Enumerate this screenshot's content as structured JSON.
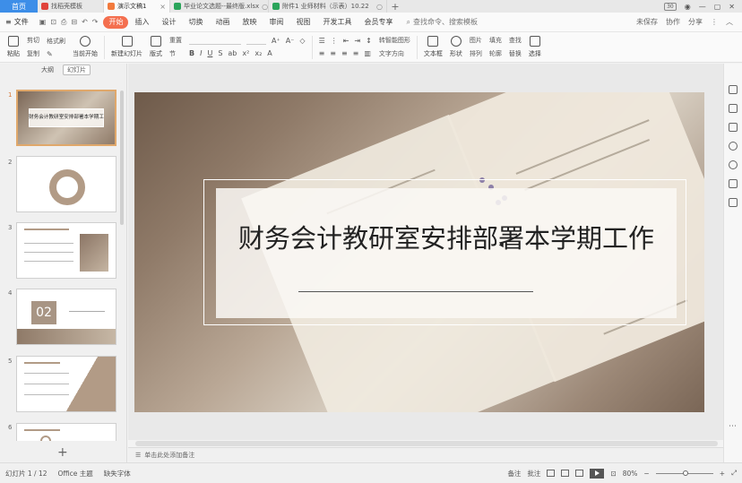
{
  "titlebar": {
    "home": "首页",
    "tabs": [
      {
        "label": "找稻壳模板",
        "color": "#e0433a",
        "active": false
      },
      {
        "label": "演示文稿1",
        "color": "#f27a3d",
        "active": true
      },
      {
        "label": "毕业论文选题--最终版.xlsx",
        "color": "#2aa45a",
        "active": false
      },
      {
        "label": "附件1 业师材料（示表）10.22",
        "color": "#2aa45a",
        "active": false
      }
    ],
    "right": [
      "囗",
      "囧",
      "—",
      "▢",
      "✕"
    ]
  },
  "menubar": {
    "file": "文件",
    "items": [
      "开始",
      "插入",
      "设计",
      "切换",
      "动画",
      "放映",
      "审阅",
      "视图",
      "开发工具",
      "会员专享"
    ],
    "active": "开始",
    "search": "查找命令、搜索模板",
    "right": [
      "未保存",
      "协作",
      "分享"
    ]
  },
  "ribbon": {
    "paste": "粘贴",
    "clip": [
      "剪切",
      "复制",
      "格式刷"
    ],
    "from_current": "当前开始",
    "new_slide": "新建幻灯片",
    "layout": "版式",
    "section": "节",
    "reset": "重置",
    "textbox": "文本框",
    "shapes": "形状",
    "arrange": "排列",
    "picture": "图片",
    "fill": "填充",
    "outline": "轮廓",
    "find": "查找",
    "replace": "替换",
    "select": "选择",
    "convert": "转智能图形",
    "text_dir": "文字方向"
  },
  "left_panel": {
    "tabs": [
      "大纲",
      "幻灯片"
    ],
    "active_tab": "幻灯片",
    "slides": [
      {
        "num": "1",
        "title": "财务会计教研室安排部署本学期工作"
      },
      {
        "num": "2",
        "title": ""
      },
      {
        "num": "3",
        "title": ""
      },
      {
        "num": "4",
        "title": "02"
      },
      {
        "num": "5",
        "title": ""
      },
      {
        "num": "6",
        "title": ""
      }
    ],
    "add": "+"
  },
  "slide": {
    "title": "财务会计教研室安排部署本学期工作"
  },
  "notes": {
    "placeholder": "单击此处添加备注"
  },
  "statusbar": {
    "page": "幻灯片 1 / 12",
    "theme": "Office 主题",
    "font": "缺失字体",
    "comment": "备注",
    "annotate": "批注",
    "zoom": "80%"
  }
}
